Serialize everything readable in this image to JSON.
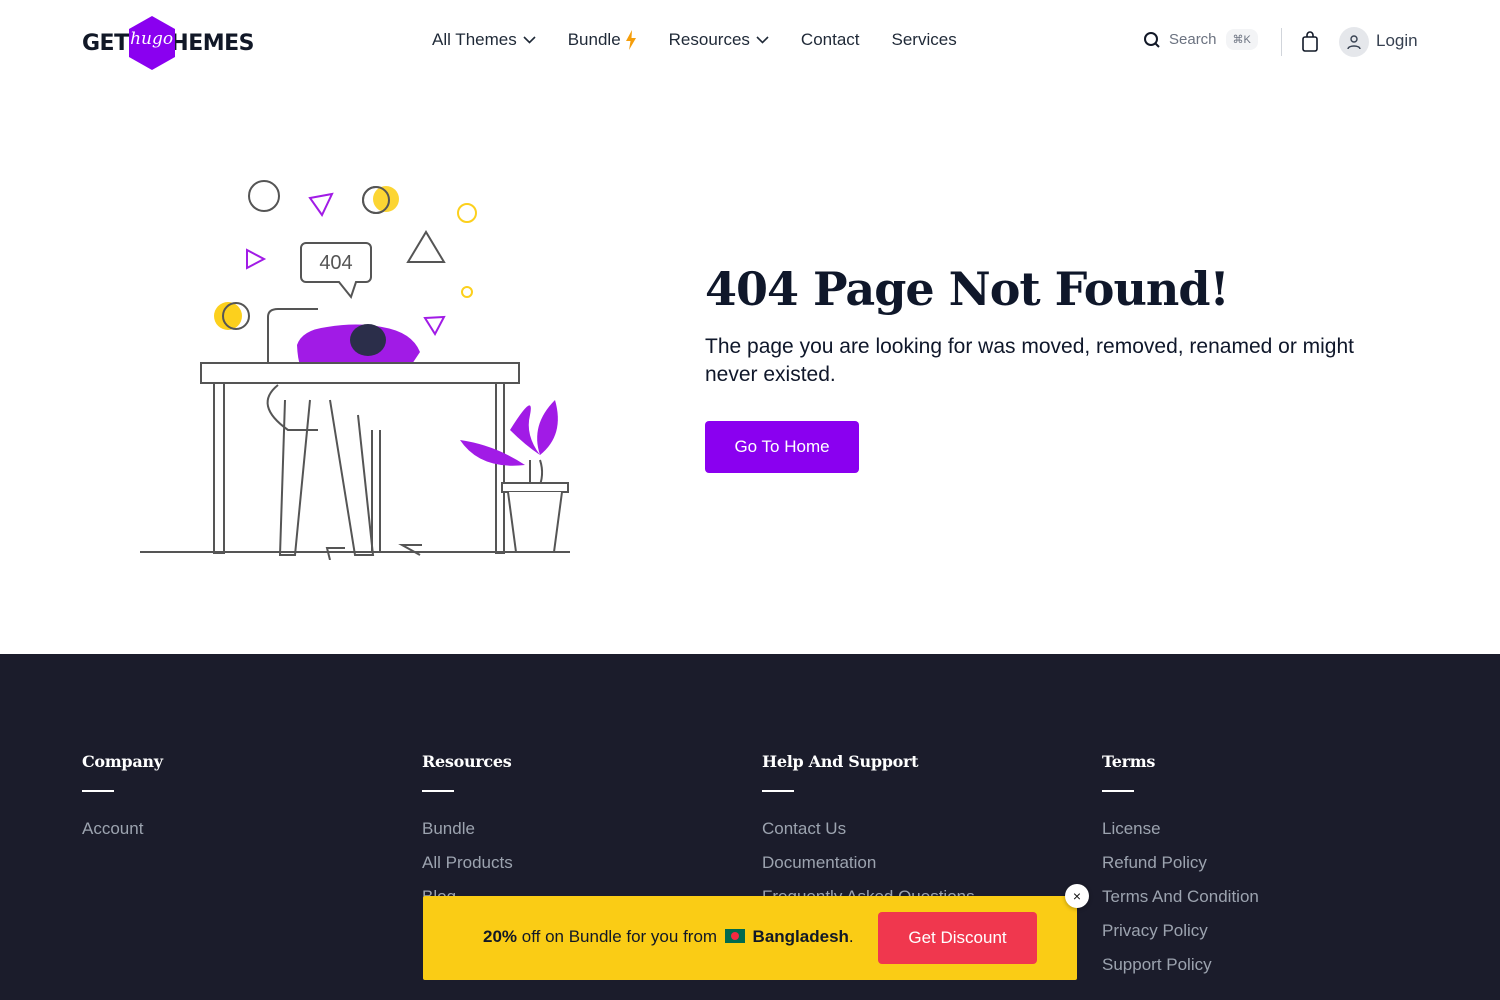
{
  "header": {
    "logo": {
      "left": "GET",
      "middle": "hugo",
      "right": "THEMES"
    },
    "nav": [
      {
        "label": "All Themes",
        "dropdown": true
      },
      {
        "label": "Bundle",
        "badge_icon": "lightning-bolt-icon"
      },
      {
        "label": "Resources",
        "dropdown": true
      },
      {
        "label": "Contact"
      },
      {
        "label": "Services"
      }
    ],
    "search": {
      "label": "Search",
      "shortcut": "⌘K"
    },
    "login_label": "Login"
  },
  "hero": {
    "illustration_bubble_text": "404",
    "title": "404 Page Not Found!",
    "description": "The page you are looking for was moved, removed, renamed or might never existed.",
    "button_label": "Go To Home"
  },
  "footer": {
    "columns": [
      {
        "heading": "Company",
        "links": [
          "Account"
        ]
      },
      {
        "heading": "Resources",
        "links": [
          "Bundle",
          "All Products",
          "Blog"
        ]
      },
      {
        "heading": "Help And Support",
        "links": [
          "Contact Us",
          "Documentation",
          "Frequently Asked Questions"
        ]
      },
      {
        "heading": "Terms",
        "links": [
          "License",
          "Refund Policy",
          "Terms And Condition",
          "Privacy Policy",
          "Support Policy"
        ]
      }
    ]
  },
  "promo": {
    "discount": "20%",
    "text_middle": "off on Bundle for you from",
    "country": "Bangladesh",
    "suffix": ".",
    "button_label": "Get Discount",
    "close_label": "×"
  },
  "colors": {
    "accent": "#8a00f0",
    "footer_bg": "#1b1c2b",
    "promo_bg": "#facc15",
    "promo_button": "#f0374e",
    "illustration_yellow": "#fcd01d"
  }
}
